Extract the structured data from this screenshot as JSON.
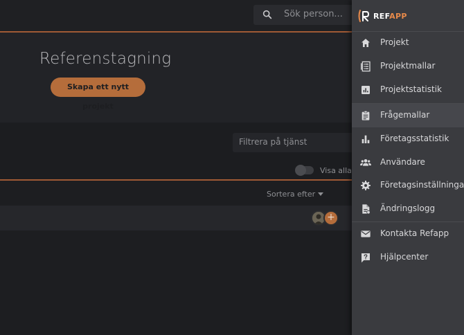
{
  "search": {
    "placeholder": "Sök person..."
  },
  "header": {
    "title": "Referenstagning",
    "new_project_label": "Skapa ett nytt projekt"
  },
  "filter": {
    "placeholder": "Filtrera på tjänst",
    "show_all_label": "Visa alla p"
  },
  "sort": {
    "label": "Sortera efter"
  },
  "project_row": {
    "add_label": "+"
  },
  "drawer": {
    "logo": {
      "brand": "REF",
      "brand_accent": "APP"
    },
    "items": [
      {
        "label": "Projekt",
        "icon": "home-icon"
      },
      {
        "label": "Projektmallar",
        "icon": "list-icon"
      },
      {
        "label": "Projektstatistik",
        "icon": "stats-icon"
      },
      {
        "label": "Frågemallar",
        "icon": "clipboard-icon",
        "active": true
      },
      {
        "label": "Företagsstatistik",
        "icon": "bar-chart-icon"
      },
      {
        "label": "Användare",
        "icon": "users-icon"
      },
      {
        "label": "Företagsinställningar",
        "icon": "gear-icon"
      },
      {
        "label": "Ändringslogg",
        "icon": "document-icon"
      },
      {
        "label": "Kontakta Refapp",
        "icon": "mail-icon"
      },
      {
        "label": "Hjälpcenter",
        "icon": "help-icon"
      }
    ]
  },
  "colors": {
    "accent": "#b56d3b",
    "background": "#1d1e21",
    "drawer": "#3a3b3f"
  }
}
